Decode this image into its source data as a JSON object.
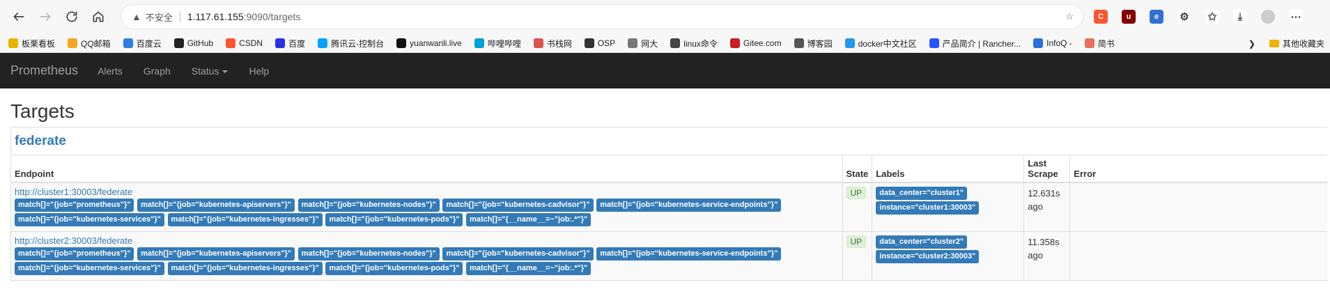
{
  "browser": {
    "insecure_label": "不安全",
    "url_host": "1.117.61.155",
    "url_port_path": ":9090/targets",
    "bookmarks": [
      {
        "label": "板栗看板",
        "icon": "chestnut-icon",
        "color": "#e8b400"
      },
      {
        "label": "QQ邮箱",
        "icon": "qq-mail-icon",
        "color": "#f5a623"
      },
      {
        "label": "百度云",
        "icon": "baidu-cloud-icon",
        "color": "#2f7fe3"
      },
      {
        "label": "GitHub",
        "icon": "github-icon",
        "color": "#222222"
      },
      {
        "label": "CSDN",
        "icon": "csdn-icon",
        "color": "#fc5531"
      },
      {
        "label": "百度",
        "icon": "baidu-icon",
        "color": "#2932e1"
      },
      {
        "label": "腾讯云-控制台",
        "icon": "tencent-cloud-icon",
        "color": "#00a4ff"
      },
      {
        "label": "yuanwanli.live",
        "icon": "notion-icon",
        "color": "#111111"
      },
      {
        "label": "哔哩哔哩",
        "icon": "bilibili-icon",
        "color": "#00a1d6"
      },
      {
        "label": "书栈网",
        "icon": "book-icon",
        "color": "#d9534f"
      },
      {
        "label": "OSP",
        "icon": "osp-icon",
        "color": "#333333"
      },
      {
        "label": "网大",
        "icon": "page-icon",
        "color": "#777777"
      },
      {
        "label": "linux命令",
        "icon": "linux-icon",
        "color": "#444444"
      },
      {
        "label": "Gitee.com",
        "icon": "gitee-icon",
        "color": "#c71d23"
      },
      {
        "label": "博客园",
        "icon": "cnblogs-icon",
        "color": "#555555"
      },
      {
        "label": "docker中文社区",
        "icon": "docker-icon",
        "color": "#2496ed"
      },
      {
        "label": "产品简介 | Rancher...",
        "icon": "rancher-icon",
        "color": "#2453ff"
      },
      {
        "label": "InfoQ -",
        "icon": "infoq-icon",
        "color": "#2a6fdb"
      },
      {
        "label": "简书",
        "icon": "jianshu-icon",
        "color": "#ea6f5a"
      }
    ],
    "other_bookmarks": "其他收藏夹"
  },
  "nav": {
    "brand": "Prometheus",
    "links": [
      "Alerts",
      "Graph",
      "Status",
      "Help"
    ]
  },
  "page": {
    "title": "Targets",
    "job": "federate",
    "columns": {
      "endpoint": "Endpoint",
      "state": "State",
      "labels": "Labels",
      "last_scrape_1": "Last",
      "last_scrape_2": "Scrape",
      "error": "Error"
    },
    "targets": [
      {
        "endpoint": "http://cluster1:30003/federate",
        "params_line1": [
          "match[]=\"{job=\"prometheus\"}\"",
          "match[]=\"{job=\"kubernetes-apiservers\"}\"",
          "match[]=\"{job=\"kubernetes-nodes\"}\"",
          "match[]=\"{job=\"kubernetes-cadvisor\"}\"",
          "match[]=\"{job=\"kubernetes-service-endpoints\"}\""
        ],
        "params_line2": [
          "match[]=\"{job=\"kubernetes-services\"}\"",
          "match[]=\"{job=\"kubernetes-ingresses\"}\"",
          "match[]=\"{job=\"kubernetes-pods\"}\"",
          "match[]=\"{__name__=~\"job:.*\"}\""
        ],
        "state": "UP",
        "labels": [
          "data_center=\"cluster1\"",
          "instance=\"cluster1:30003\""
        ],
        "last_scrape_1": "12.631s",
        "last_scrape_2": "ago",
        "error": ""
      },
      {
        "endpoint": "http://cluster2:30003/federate",
        "params_line1": [
          "match[]=\"{job=\"prometheus\"}\"",
          "match[]=\"{job=\"kubernetes-apiservers\"}\"",
          "match[]=\"{job=\"kubernetes-nodes\"}\"",
          "match[]=\"{job=\"kubernetes-cadvisor\"}\"",
          "match[]=\"{job=\"kubernetes-service-endpoints\"}\""
        ],
        "params_line2": [
          "match[]=\"{job=\"kubernetes-services\"}\"",
          "match[]=\"{job=\"kubernetes-ingresses\"}\"",
          "match[]=\"{job=\"kubernetes-pods\"}\"",
          "match[]=\"{__name__=~\"job:.*\"}\""
        ],
        "state": "UP",
        "labels": [
          "data_center=\"cluster2\"",
          "instance=\"cluster2:30003\""
        ],
        "last_scrape_1": "11.358s",
        "last_scrape_2": "ago",
        "error": ""
      }
    ]
  }
}
